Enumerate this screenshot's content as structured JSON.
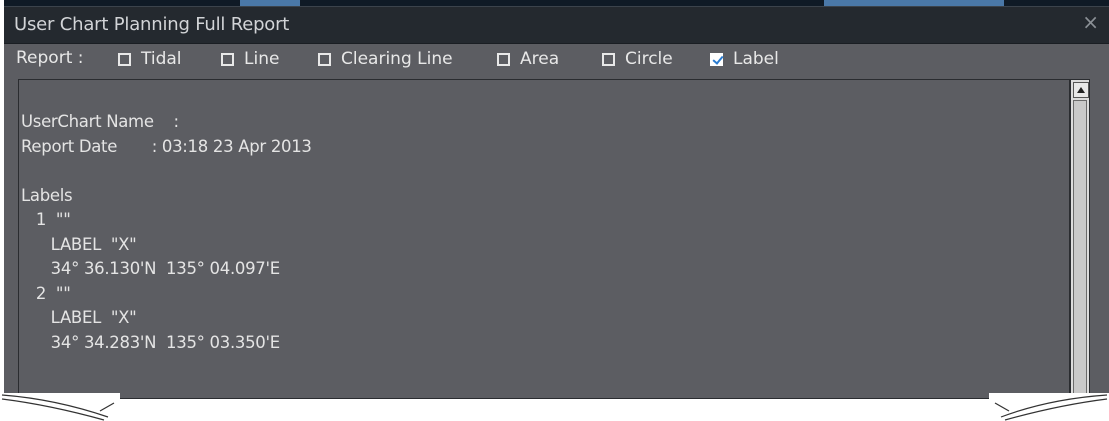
{
  "window": {
    "title": "User Chart Planning Full Report",
    "close_glyph": "×"
  },
  "report": {
    "label": "Report :",
    "options": [
      {
        "label": "Tidal",
        "checked": false
      },
      {
        "label": "Line",
        "checked": false
      },
      {
        "label": "Clearing Line",
        "checked": false
      },
      {
        "label": "Area",
        "checked": false
      },
      {
        "label": "Circle",
        "checked": false
      },
      {
        "label": "Label",
        "checked": true
      }
    ]
  },
  "content": {
    "lines": [
      "UserChart Name    :",
      "Report Date       : 03:18 23 Apr 2013",
      "",
      "Labels",
      "   1  \"\"",
      "      LABEL  \"X\"",
      "      34° 36.130'N  135° 04.097'E",
      "   2  \"\"",
      "      LABEL  \"X\"",
      "      34° 34.283'N  135° 03.350'E"
    ]
  },
  "colors": {
    "background": "#5c5d62",
    "titlebar": "#24292f",
    "text": "#e4e4e4",
    "check_accent": "#2a7bd0"
  },
  "icons": {
    "close": "close-icon",
    "scroll_up": "scroll-up-arrow-icon"
  }
}
